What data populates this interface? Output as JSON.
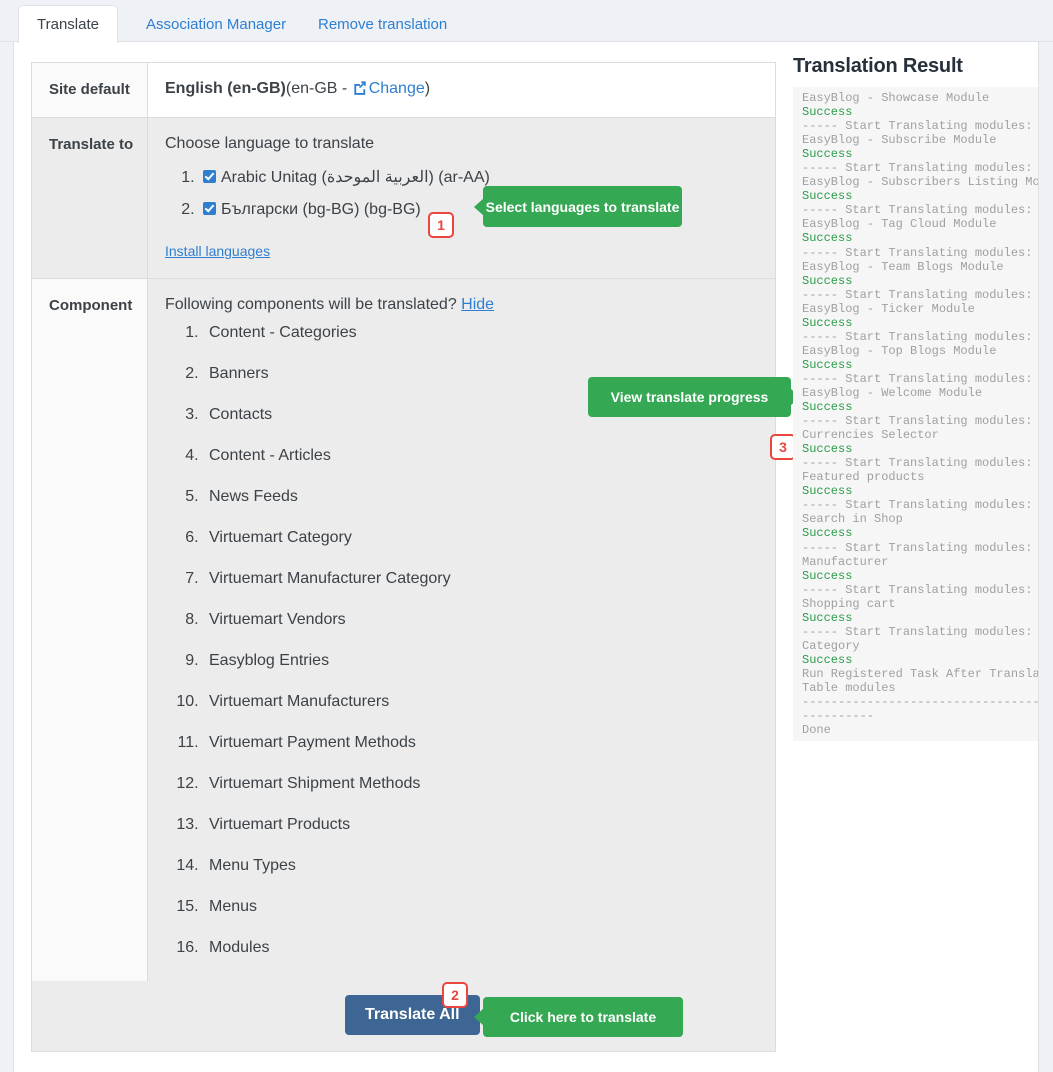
{
  "tabs": [
    {
      "label": "Translate",
      "active": true
    },
    {
      "label": "Association Manager",
      "active": false
    },
    {
      "label": "Remove translation",
      "active": false
    }
  ],
  "table": {
    "site_default": {
      "label": "Site default",
      "language_name": "English (en-GB)",
      "paren_open": "(en-GB - ",
      "change_link": "Change",
      "paren_close": ")"
    },
    "translate_to": {
      "label": "Translate to",
      "heading": "Choose language to translate",
      "languages": [
        {
          "label": "Arabic Unitag (العربية الموحدة) (ar-AA)",
          "checked": true
        },
        {
          "label": "Български (bg-BG) (bg-BG)",
          "checked": true
        }
      ],
      "install_link": "Install languages"
    },
    "component": {
      "label": "Component",
      "heading": "Following components will be translated?",
      "hide_link": "Hide",
      "items": [
        "Content - Categories",
        "Banners",
        "Contacts",
        "Content - Articles",
        "News Feeds",
        "Virtuemart Category",
        "Virtuemart Manufacturer Category",
        "Virtuemart Vendors",
        "Easyblog Entries",
        "Virtuemart Manufacturers",
        "Virtuemart Payment Methods",
        "Virtuemart Shipment Methods",
        "Virtuemart Products",
        "Menu Types",
        "Menus",
        "Modules"
      ]
    }
  },
  "footer": {
    "translate_all_label": "Translate All"
  },
  "callouts": [
    {
      "id": "co-lang",
      "text": "Select languages to translate"
    },
    {
      "id": "co-prog",
      "text": "View translate progress"
    },
    {
      "id": "co-click",
      "text": "Click here to translate"
    }
  ],
  "badges": [
    {
      "id": "bd1",
      "number": "1"
    },
    {
      "id": "bd2",
      "number": "2"
    },
    {
      "id": "bd3",
      "number": "3"
    }
  ],
  "result": {
    "title": "Translation Result",
    "log": [
      {
        "text": "EasyBlog - Showcase Module",
        "ok": false
      },
      {
        "text": "Success",
        "ok": true
      },
      {
        "text": "----- Start Translating modules:",
        "ok": false
      },
      {
        "text": "EasyBlog - Subscribe Module",
        "ok": false
      },
      {
        "text": "Success",
        "ok": true
      },
      {
        "text": "----- Start Translating modules:",
        "ok": false
      },
      {
        "text": "EasyBlog - Subscribers Listing Mo",
        "ok": false
      },
      {
        "text": "Success",
        "ok": true
      },
      {
        "text": "----- Start Translating modules:",
        "ok": false
      },
      {
        "text": "EasyBlog - Tag Cloud Module",
        "ok": false
      },
      {
        "text": "Success",
        "ok": true
      },
      {
        "text": "----- Start Translating modules:",
        "ok": false
      },
      {
        "text": "EasyBlog - Team Blogs Module",
        "ok": false
      },
      {
        "text": "Success",
        "ok": true
      },
      {
        "text": "----- Start Translating modules:",
        "ok": false
      },
      {
        "text": "EasyBlog - Ticker Module",
        "ok": false
      },
      {
        "text": "Success",
        "ok": true
      },
      {
        "text": "----- Start Translating modules:",
        "ok": false
      },
      {
        "text": "EasyBlog - Top Blogs Module",
        "ok": false
      },
      {
        "text": "Success",
        "ok": true
      },
      {
        "text": "----- Start Translating modules:",
        "ok": false
      },
      {
        "text": "EasyBlog - Welcome Module",
        "ok": false
      },
      {
        "text": "Success",
        "ok": true
      },
      {
        "text": "----- Start Translating modules: V",
        "ok": false
      },
      {
        "text": "Currencies Selector",
        "ok": false
      },
      {
        "text": "Success",
        "ok": true
      },
      {
        "text": "----- Start Translating modules: V",
        "ok": false
      },
      {
        "text": "Featured products",
        "ok": false
      },
      {
        "text": "Success",
        "ok": true
      },
      {
        "text": "----- Start Translating modules: V",
        "ok": false
      },
      {
        "text": "Search in Shop",
        "ok": false
      },
      {
        "text": "Success",
        "ok": true
      },
      {
        "text": "----- Start Translating modules: V",
        "ok": false
      },
      {
        "text": "Manufacturer",
        "ok": false
      },
      {
        "text": "Success",
        "ok": true
      },
      {
        "text": "----- Start Translating modules: V",
        "ok": false
      },
      {
        "text": "Shopping cart",
        "ok": false
      },
      {
        "text": "Success",
        "ok": true
      },
      {
        "text": "----- Start Translating modules: V",
        "ok": false
      },
      {
        "text": "Category",
        "ok": false
      },
      {
        "text": "Success",
        "ok": true
      },
      {
        "text": "Run Registered Task After Transla",
        "ok": false
      },
      {
        "text": "Table modules",
        "ok": false
      },
      {
        "text": "----------------------------------",
        "ok": false
      },
      {
        "text": "----------",
        "ok": false
      },
      {
        "text": "Done",
        "ok": false
      }
    ]
  }
}
